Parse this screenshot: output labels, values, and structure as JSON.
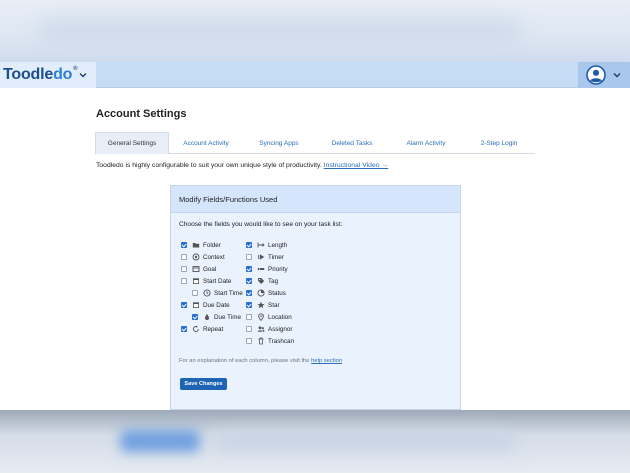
{
  "app": {
    "logo_main": "Toodle",
    "logo_accent": "do",
    "logo_mark": "®"
  },
  "page": {
    "title": "Account Settings",
    "intro_text": "Toodledo is highly configurable to suit your own unique style of productivity.",
    "intro_link": "Instructional Video →"
  },
  "tabs": [
    {
      "label": "General Settings",
      "active": true
    },
    {
      "label": "Account Activity",
      "active": false
    },
    {
      "label": "Syncing Apps",
      "active": false
    },
    {
      "label": "Deleted Tasks",
      "active": false
    },
    {
      "label": "Alarm Activity",
      "active": false
    },
    {
      "label": "2-Step Login",
      "active": false
    }
  ],
  "panel": {
    "title": "Modify Fields/Functions Used",
    "subtitle": "Choose the fields you would like to see on your task list:",
    "help_text": "For an explanation of each column, please visit the",
    "help_link": "help section",
    "save_label": "Save Changes"
  },
  "fields_left": [
    {
      "label": "Folder",
      "checked": true,
      "icon": "folder-icon"
    },
    {
      "label": "Context",
      "checked": false,
      "icon": "context-icon"
    },
    {
      "label": "Goal",
      "checked": false,
      "icon": "goal-icon"
    },
    {
      "label": "Start Date",
      "checked": false,
      "icon": "calendar-icon"
    },
    {
      "label": "Start Time",
      "checked": false,
      "icon": "clock-icon",
      "indent": true
    },
    {
      "label": "Due Date",
      "checked": true,
      "icon": "calendar-icon"
    },
    {
      "label": "Due Time",
      "checked": true,
      "icon": "drop-icon",
      "indent": true
    },
    {
      "label": "Repeat",
      "checked": true,
      "icon": "repeat-icon"
    }
  ],
  "fields_right": [
    {
      "label": "Length",
      "checked": true,
      "icon": "length-icon"
    },
    {
      "label": "Timer",
      "checked": false,
      "icon": "timer-icon"
    },
    {
      "label": "Priority",
      "checked": true,
      "icon": "priority-icon"
    },
    {
      "label": "Tag",
      "checked": true,
      "icon": "tag-icon"
    },
    {
      "label": "Status",
      "checked": true,
      "icon": "status-icon"
    },
    {
      "label": "Star",
      "checked": true,
      "icon": "star-icon"
    },
    {
      "label": "Location",
      "checked": false,
      "icon": "location-icon"
    },
    {
      "label": "Assignor",
      "checked": false,
      "icon": "assignor-icon"
    },
    {
      "label": "Trashcan",
      "checked": false,
      "icon": "trash-icon"
    }
  ],
  "colors": {
    "accent": "#2a6fd0",
    "topbar": "#c6dbf6",
    "panel": "#eaf2fd",
    "button": "#1e63b4"
  }
}
